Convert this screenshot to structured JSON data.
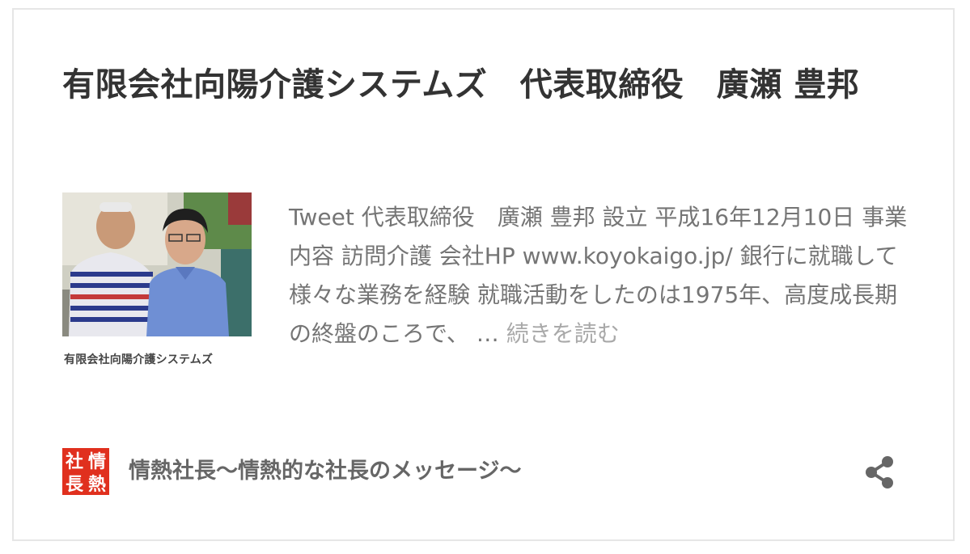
{
  "card": {
    "title": "有限会社向陽介護システムズ　代表取締役　廣瀬 豊邦",
    "thumbnail": {
      "caption": "有限会社向陽介護システムズ"
    },
    "excerpt": "Tweet 代表取締役　廣瀬 豊邦 設立 平成16年12月10日 事業内容 訪問介護 会社HP www.koyokaigo.jp/ 銀行に就職して様々な業務を経験 就職活動をしたのは1975年、高度成長期の終盤のころで、 … ",
    "read_more": "続きを読む"
  },
  "footer": {
    "site_logo_text": [
      "社",
      "情",
      "長",
      "熱"
    ],
    "site_name": "情熱社長〜情熱的な社長のメッセージ〜",
    "share_icon": "share-icon"
  },
  "colors": {
    "title": "#333333",
    "excerpt": "#757575",
    "read_more": "#a9a9a9",
    "logo_red": "#e0301e",
    "share_icon": "#666666",
    "border": "#e6e6e6"
  }
}
